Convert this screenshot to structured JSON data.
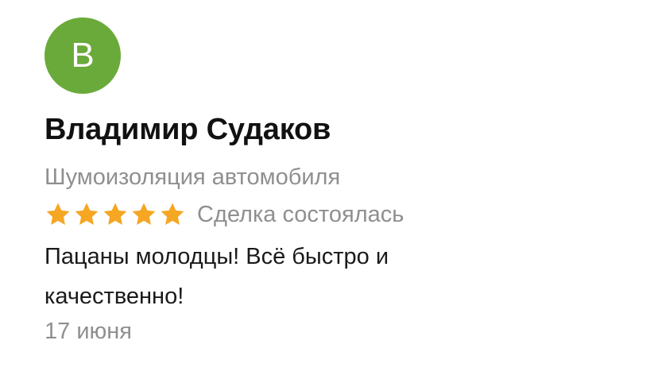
{
  "review": {
    "avatar_letter": "В",
    "avatar_color": "#6aaa3a",
    "author_name": "Владимир Судаков",
    "service": "Шумоизоляция автомобиля",
    "rating": 5,
    "rating_max": 5,
    "star_color": "#f5a623",
    "deal_status": "Сделка состоялась",
    "text": "Пацаны молодцы! Всё быстро и качественно!",
    "date": "17 июня"
  }
}
